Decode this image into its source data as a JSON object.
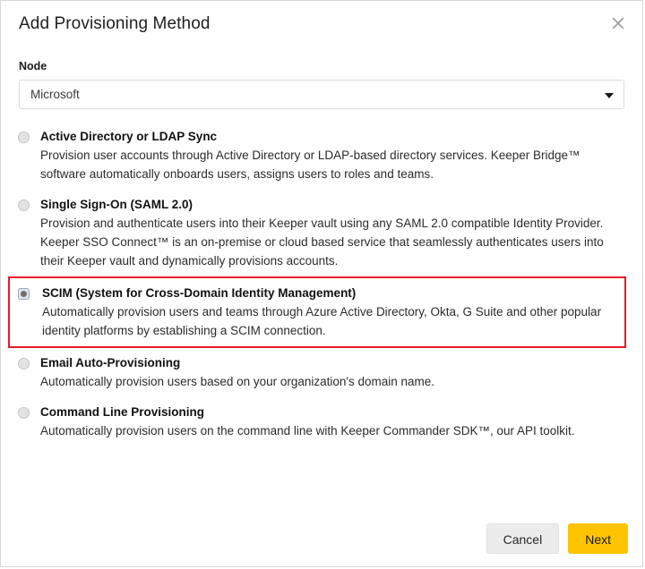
{
  "dialog": {
    "title": "Add Provisioning Method",
    "close_icon": "close-icon"
  },
  "node_field": {
    "label": "Node",
    "value": "Microsoft",
    "arrow_icon": "chevron-down-icon"
  },
  "options": [
    {
      "id": "active-directory-ldap-sync",
      "title": "Active Directory or LDAP Sync",
      "description": "Provision user accounts through Active Directory or LDAP-based directory services. Keeper Bridge™ software automatically onboards users, assigns users to roles and teams.",
      "selected": false,
      "highlighted": false
    },
    {
      "id": "single-sign-on-saml",
      "title": "Single Sign-On (SAML 2.0)",
      "description": "Provision and authenticate users into their Keeper vault using any SAML 2.0 compatible Identity Provider. Keeper SSO Connect™ is an on-premise or cloud based service that seamlessly authenticates users into their Keeper vault and dynamically provisions accounts.",
      "selected": false,
      "highlighted": false
    },
    {
      "id": "scim",
      "title": "SCIM (System for Cross-Domain Identity Management)",
      "description": "Automatically provision users and teams through Azure Active Directory, Okta, G Suite and other popular identity platforms by establishing a SCIM connection.",
      "selected": true,
      "highlighted": true
    },
    {
      "id": "email-auto-provisioning",
      "title": "Email Auto-Provisioning",
      "description": "Automatically provision users based on your organization's domain name.",
      "selected": false,
      "highlighted": false
    },
    {
      "id": "command-line-provisioning",
      "title": "Command Line Provisioning",
      "description": "Automatically provision users on the command line with Keeper Commander SDK™, our API toolkit.",
      "selected": false,
      "highlighted": false
    }
  ],
  "footer": {
    "cancel_label": "Cancel",
    "next_label": "Next"
  },
  "colors": {
    "primary_button": "#ffc400",
    "highlight_border": "#e8192c",
    "cancel_button": "#ececec"
  }
}
